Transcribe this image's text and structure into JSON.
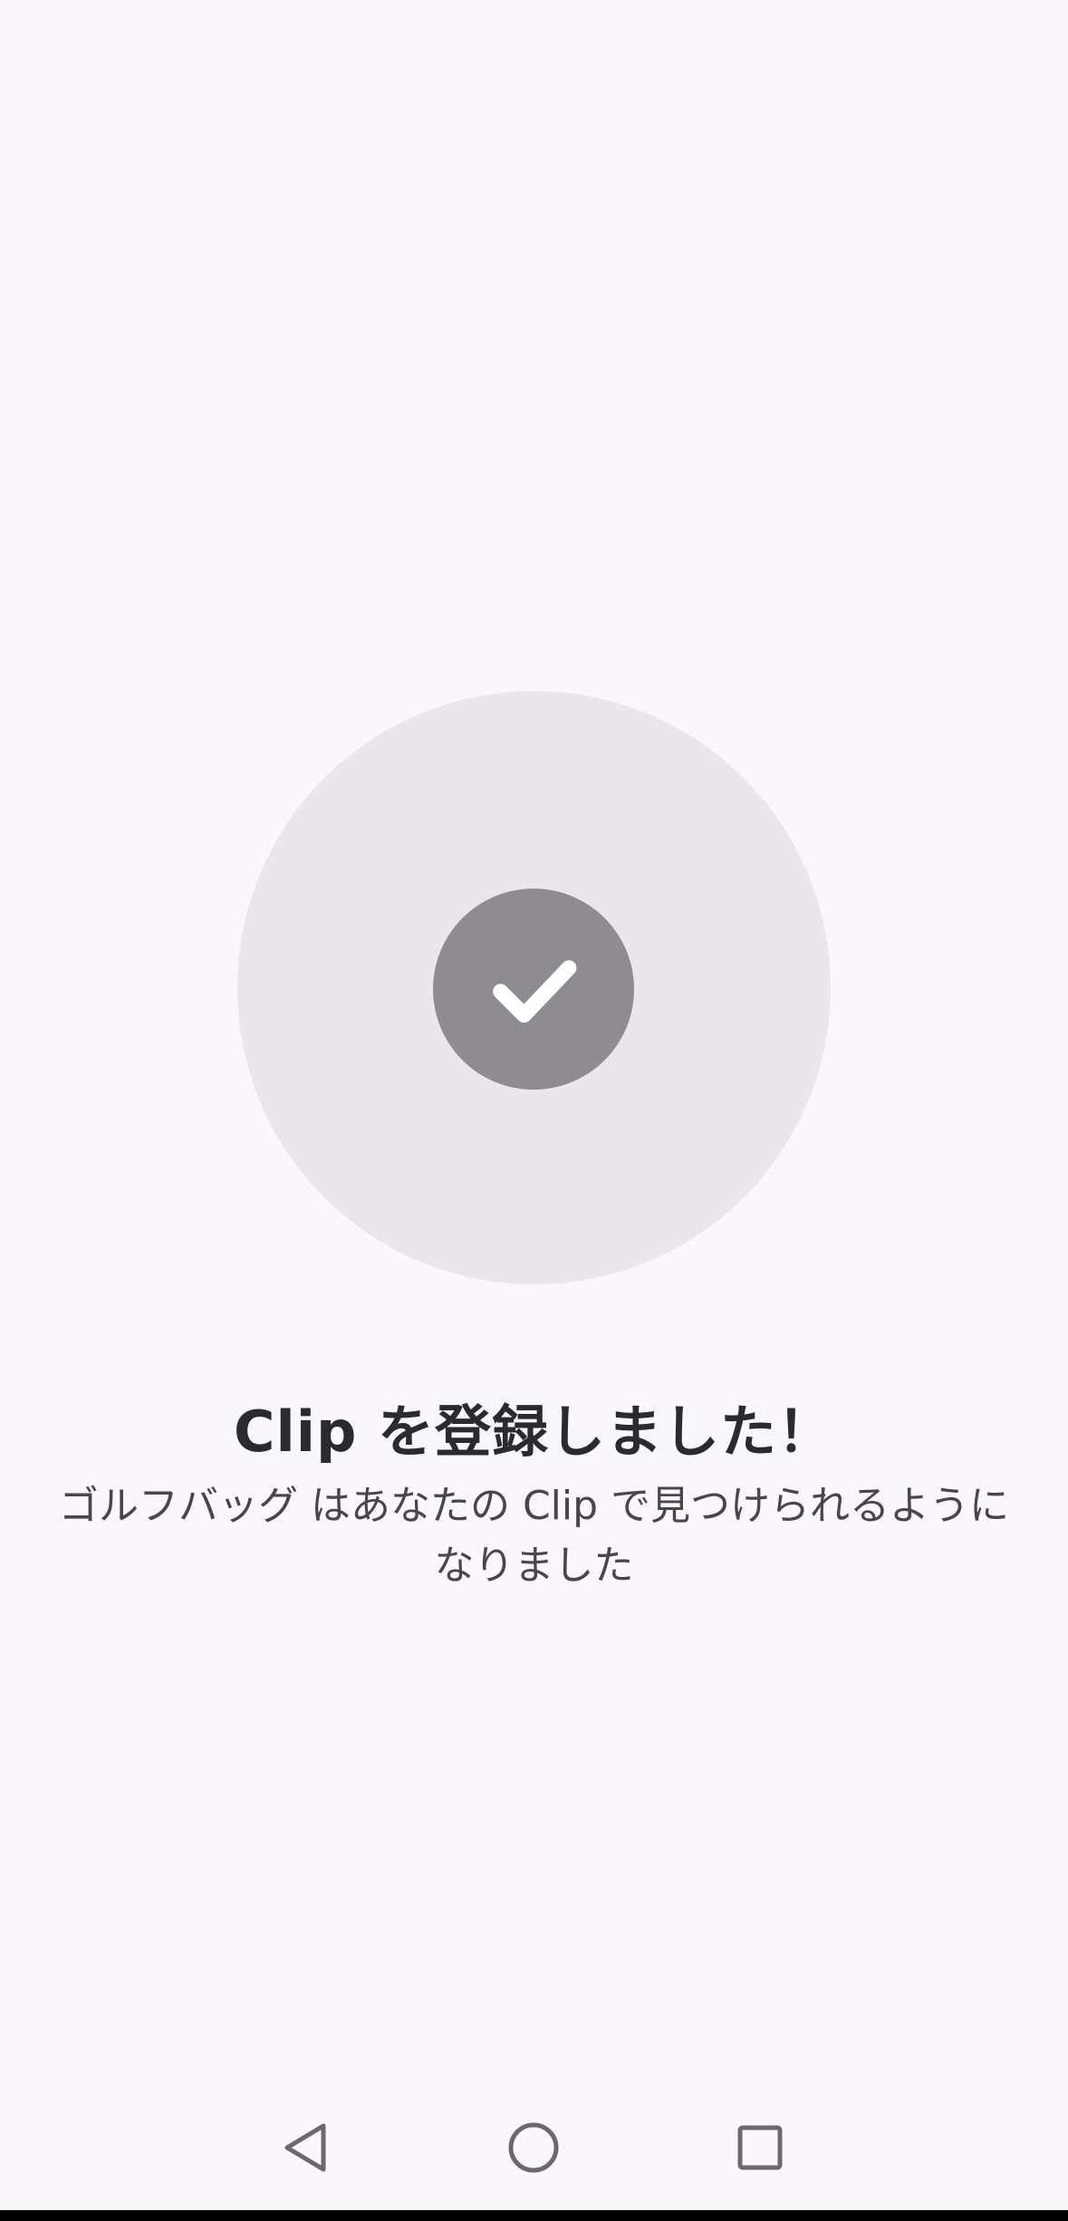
{
  "success": {
    "title": "Clip を登録しました！",
    "message": "ゴルフバッグ はあなたの Clip で見つけられるように なりました",
    "icon": "check-icon"
  },
  "navbar": {
    "back_icon": "back-triangle-icon",
    "home_icon": "home-circle-icon",
    "recent_icon": "recent-apps-square-icon"
  },
  "colors": {
    "background": "#f9f7fa",
    "outer_circle": "#e9e7ea",
    "inner_circle": "#8e8c90",
    "check": "#ffffff",
    "title_text": "#2b2a2d",
    "body_text": "#48464a",
    "nav_icons": "#6b696d"
  }
}
